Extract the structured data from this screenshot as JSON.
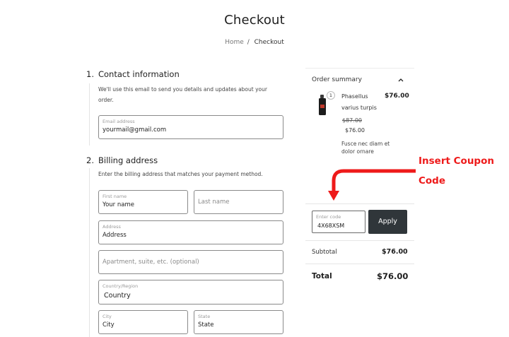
{
  "page": {
    "title": "Checkout",
    "breadcrumb": {
      "home": "Home",
      "separator": "/",
      "current": "Checkout"
    }
  },
  "contact": {
    "number": "1.",
    "title": "Contact information",
    "helper": "We'll use this email to send you details and updates about your order.",
    "email": {
      "label": "Email address",
      "value": "yourmail@gmail.com"
    }
  },
  "billing": {
    "number": "2.",
    "title": "Billing address",
    "helper": "Enter the billing address that matches your payment method.",
    "first_name": {
      "label": "First name",
      "value": "Your name"
    },
    "last_name": {
      "placeholder": "Last name"
    },
    "address": {
      "label": "Address",
      "value": "Address"
    },
    "apartment": {
      "placeholder": "Apartment, suite, etc. (optional)"
    },
    "country": {
      "label": "Country/Region",
      "value": "Country"
    },
    "city": {
      "label": "City",
      "value": "City"
    },
    "state": {
      "label": "State",
      "value": "State"
    }
  },
  "summary": {
    "title": "Order summary",
    "product": {
      "quantity": "1",
      "name": "Phasellus varius turpis",
      "price": "$76.00",
      "old_price": "$87.00",
      "new_price": "$76.00",
      "description": "Fusce nec diam et dolor ornare"
    },
    "coupon": {
      "label": "Enter code",
      "value": "4X68XSM",
      "apply_label": "Apply"
    },
    "subtotal": {
      "label": "Subtotal",
      "value": "$76.00"
    },
    "total": {
      "label": "Total",
      "value": "$76.00"
    }
  },
  "annotation": {
    "line1": "Insert Coupon",
    "line2": "Code",
    "color": "#ee1a1a"
  },
  "colors": {
    "apply_button": "#30363a",
    "field_border": "#8a8a8a"
  },
  "icons": {
    "collapse": "chevron-up-icon",
    "product": "perfume-bottle-icon",
    "annotation": "arrow-down-icon"
  }
}
